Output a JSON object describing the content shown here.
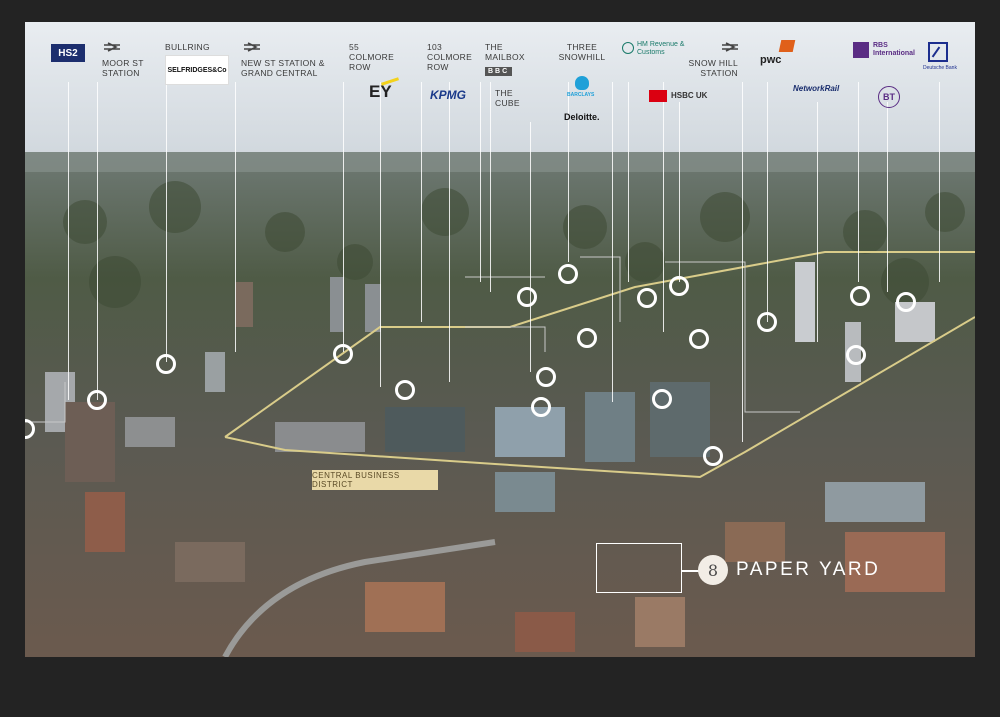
{
  "labels": {
    "hs2": "HS2",
    "moor_st": "MOOR ST STATION",
    "bullring": "BULLRING",
    "selfridges": "SELFRIDGES&Co",
    "new_st": "NEW ST STATION & GRAND CENTRAL",
    "colmore_55": "55 COLMORE ROW",
    "ey": "EY",
    "colmore_103": "103 COLMORE ROW",
    "kpmg": "KPMG",
    "mailbox": "THE MAILBOX",
    "bbc": "BBC",
    "cube": "THE CUBE",
    "snowhill3": "THREE SNOWHILL",
    "barclays": "BARCLAYS",
    "deloitte": "Deloitte.",
    "hmrc": "HM Revenue & Customs",
    "hsbc": "HSBC UK",
    "snowhill_station": "SNOW HILL STATION",
    "pwc": "pwc",
    "network_rail": "NetworkRail",
    "rbs": "RBS International",
    "bt": "BT",
    "deutsche": "Deutsche Bank"
  },
  "cbd_label": "CENTRAL BUSINESS DISTRICT",
  "paper_yard": "PAPER YARD",
  "colors": {
    "sky": "#dfe6ed",
    "city": "#5f6a5c",
    "outline": "#d9cc8a",
    "ring": "#ffffff"
  }
}
